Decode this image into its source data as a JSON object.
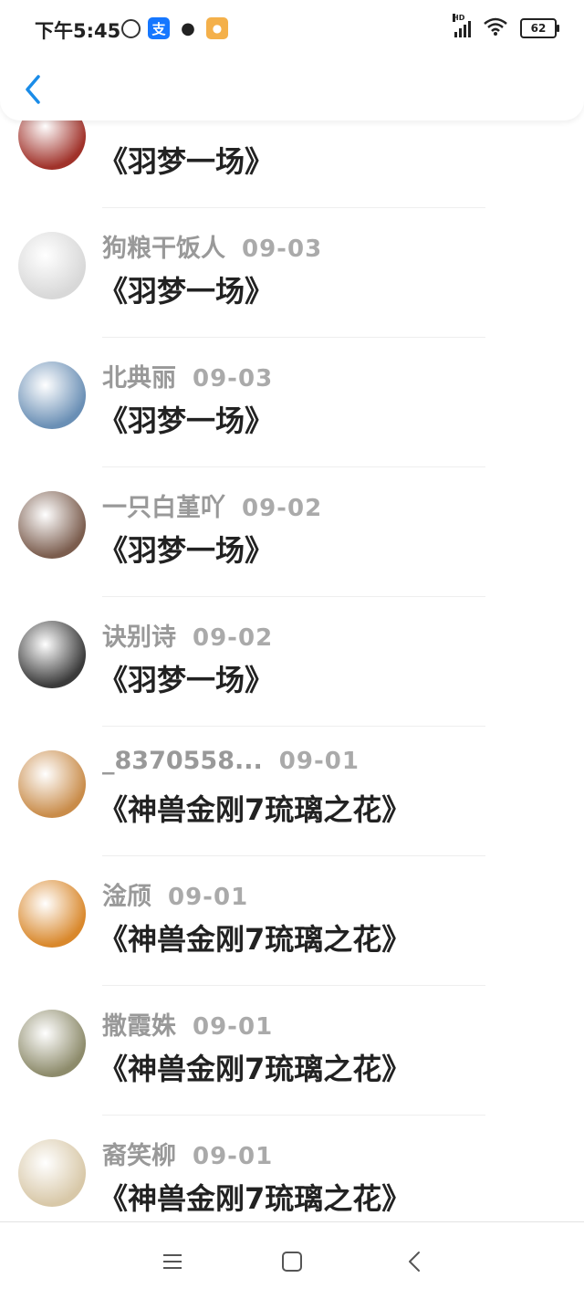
{
  "status_bar": {
    "time": "下午5:45",
    "battery": "62",
    "signal_tag": "HD",
    "icons": [
      "alarm-icon",
      "alipay-icon",
      "paw-icon",
      "app-icon",
      "signal-icon",
      "wifi-icon",
      "battery-icon"
    ]
  },
  "header": {
    "back_icon": "chevron-left-icon"
  },
  "list": {
    "items": [
      {
        "name": "",
        "date": "",
        "title": "《羽梦一场》",
        "avatar_color": "#a0322a"
      },
      {
        "name": "狗粮干饭人",
        "date": "09-03",
        "title": "《羽梦一场》",
        "avatar_color": "#d8d8d8"
      },
      {
        "name": "北典丽",
        "date": "09-03",
        "title": "《羽梦一场》",
        "avatar_color": "#6a8fb5"
      },
      {
        "name": "一只白堇吖",
        "date": "09-02",
        "title": "《羽梦一场》",
        "avatar_color": "#7b5d4e"
      },
      {
        "name": "诀别诗",
        "date": "09-02",
        "title": "《羽梦一场》",
        "avatar_color": "#3a3a3a"
      },
      {
        "name": "_8370558...",
        "date": "09-01",
        "title": "《神兽金刚7琉璃之花》",
        "avatar_color": "#c98c4a"
      },
      {
        "name": "淦颀",
        "date": "09-01",
        "title": "《神兽金刚7琉璃之花》",
        "avatar_color": "#d9882c"
      },
      {
        "name": "撒霞姝",
        "date": "09-01",
        "title": "《神兽金刚7琉璃之花》",
        "avatar_color": "#8d8b6b"
      },
      {
        "name": "裔笑柳",
        "date": "09-01",
        "title": "《神兽金刚7琉璃之花》",
        "avatar_color": "#d8c8a8"
      }
    ]
  },
  "nav_bar": {
    "icons": [
      "menu-icon",
      "home-icon",
      "back-icon"
    ]
  },
  "colors": {
    "accent": "#1a8ce8",
    "title_text": "#222222",
    "meta_text": "#999999"
  }
}
